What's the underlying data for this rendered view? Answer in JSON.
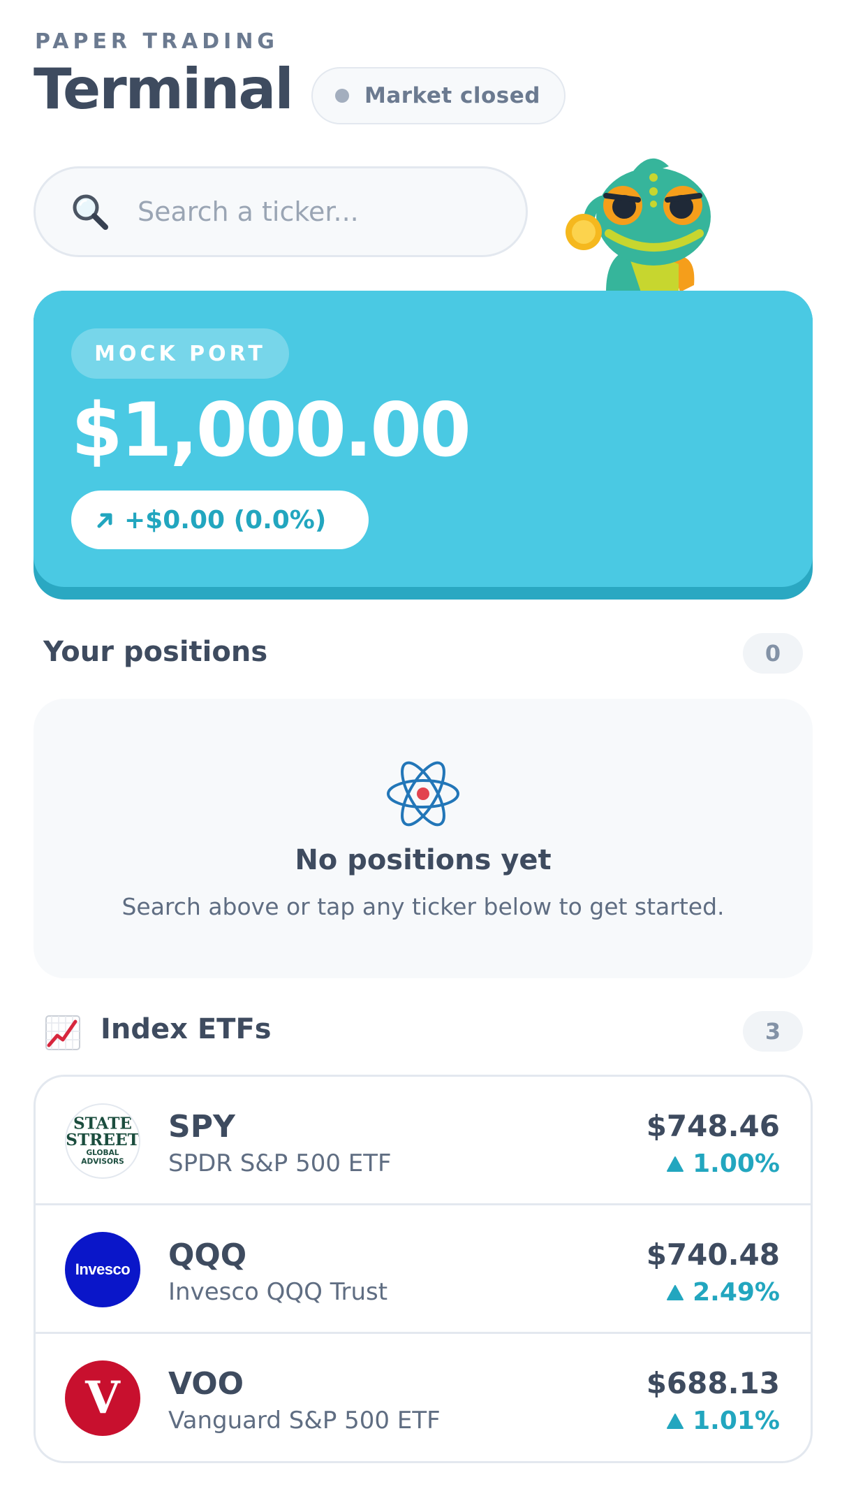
{
  "header": {
    "eyebrow": "PAPER TRADING",
    "title": "Terminal",
    "market_status": "Market closed"
  },
  "search": {
    "placeholder": "Search a ticker..."
  },
  "portfolio": {
    "tag": "MOCK PORT",
    "value": "$1,000.00",
    "change": "+$0.00 (0.0%)"
  },
  "positions": {
    "title": "Your positions",
    "count": "0",
    "empty_title": "No positions yet",
    "empty_text": "Search above or tap any ticker below to get started."
  },
  "etfs": {
    "title": "Index ETFs",
    "count": "3",
    "items": [
      {
        "ticker": "SPY",
        "name": "SPDR S&P 500 ETF",
        "price": "$748.46",
        "change": "1.00%",
        "logo": "state-street-logo",
        "logo_lines": [
          "STATE",
          "STREET",
          "GLOBAL",
          "ADVISORS"
        ]
      },
      {
        "ticker": "QQQ",
        "name": "Invesco QQQ Trust",
        "price": "$740.48",
        "change": "2.49%",
        "logo": "invesco-logo",
        "logo_text": "Invesco"
      },
      {
        "ticker": "VOO",
        "name": "Vanguard S&P 500 ETF",
        "price": "$688.13",
        "change": "1.01%",
        "logo": "vanguard-logo",
        "logo_text": "V"
      }
    ]
  },
  "colors": {
    "accent": "#4ac9e3",
    "positive": "#22a6bf",
    "text": "#3e4b5f"
  }
}
